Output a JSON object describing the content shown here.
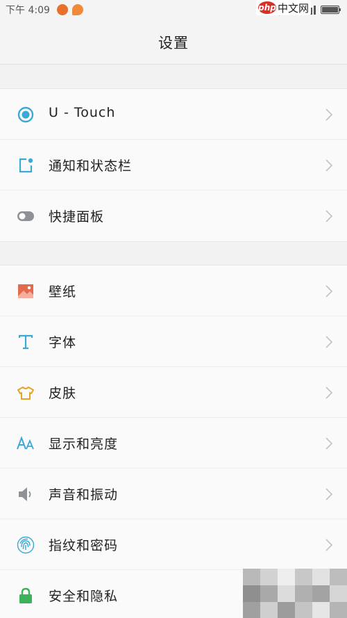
{
  "status_bar": {
    "time": "下午 4:09"
  },
  "watermark": {
    "badge": "php",
    "text": "中文网"
  },
  "header": {
    "title": "设置"
  },
  "groups": [
    {
      "items": [
        {
          "label": "U - Touch",
          "icon": "utouch-icon"
        },
        {
          "label": "通知和状态栏",
          "icon": "notification-icon"
        },
        {
          "label": "快捷面板",
          "icon": "toggle-icon"
        }
      ]
    },
    {
      "items": [
        {
          "label": "壁纸",
          "icon": "wallpaper-icon"
        },
        {
          "label": "字体",
          "icon": "font-icon"
        },
        {
          "label": "皮肤",
          "icon": "shirt-icon"
        },
        {
          "label": "显示和亮度",
          "icon": "display-icon"
        },
        {
          "label": "声音和振动",
          "icon": "speaker-icon"
        },
        {
          "label": "指纹和密码",
          "icon": "fingerprint-icon"
        },
        {
          "label": "安全和隐私",
          "icon": "lock-icon"
        }
      ]
    }
  ],
  "colors": {
    "utouch": "#3aa9d6",
    "notification": "#3aa9d6",
    "toggle": "#8e9196",
    "wallpaper": "#e46a4e",
    "font": "#3aa9d6",
    "shirt": "#e0a52a",
    "display": "#3aa9d6",
    "speaker": "#8e9196",
    "fingerprint": "#3aa9d6",
    "lock": "#3cb35a",
    "chevron": "#c2c2c2"
  }
}
